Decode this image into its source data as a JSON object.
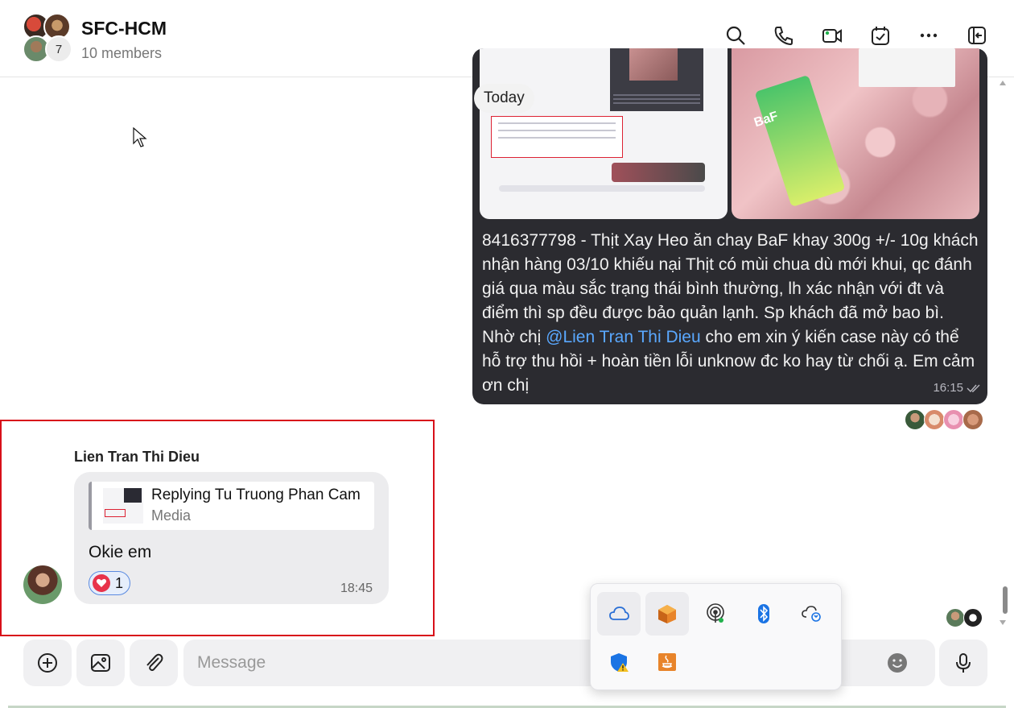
{
  "header": {
    "group_name": "SFC-HCM",
    "members": "10 members",
    "avatar_overflow_count": "7"
  },
  "chat": {
    "date_chip": "Today",
    "outgoing": {
      "text_before_mention": "8416377798 - Thịt Xay Heo ăn chay BaF khay 300g +/- 10g khách nhận hàng 03/10 khiếu nại Thịt có mùi chua dù mới khui, qc đánh giá qua màu sắc trạng thái bình thường, lh xác nhận với đt và điểm thì sp đều được bảo quản lạnh. Sp khách đã mở bao bì. Nhờ chị ",
      "mention": "@Lien Tran Thi Dieu",
      "text_after_mention": " cho em xin ý kiến case này có thể hỗ trợ thu hồi + hoàn tiền lỗi unknow đc ko hay từ chối ạ. Em cảm ơn chị",
      "time": "16:15",
      "image_label": "BaF"
    },
    "incoming": {
      "sender": "Lien Tran Thi Dieu",
      "reply_title": "Replying Tu Truong Phan Cam",
      "reply_subtitle": "Media",
      "text": "Okie em",
      "reaction_count": "1",
      "time": "18:45"
    }
  },
  "composer": {
    "placeholder": "Message"
  },
  "tray": {
    "icons": [
      "cloud-icon",
      "app-orange-icon",
      "podcast-icon",
      "bluetooth-icon",
      "cloud-sync-icon",
      "security-shield-icon",
      "java-icon"
    ]
  },
  "colors": {
    "accent": "#5aa8ff",
    "bubble_dark": "#2b2b30",
    "highlight": "#d8101a",
    "heart": "#e8334a"
  }
}
